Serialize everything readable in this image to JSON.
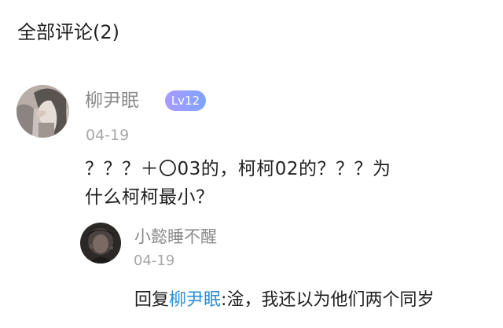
{
  "header": {
    "title": "全部评论(2)"
  },
  "comment": {
    "username": "柳尹眠",
    "level": "Lv12",
    "date": "04-19",
    "text_line1": "？？？＋〇03的，柯柯02的？？？为",
    "text_line2": "什么柯柯最小？"
  },
  "reply": {
    "username": "小懿睡不醒",
    "date": "04-19",
    "prefix": "回复",
    "mention": "柳尹眠",
    "separator": ":",
    "text": "淦，我还以为他们两个同岁"
  },
  "colors": {
    "mention": "#2c8fd9",
    "username": "#8a8a8a",
    "date": "#a7a7a7",
    "badge_start": "#a99bff",
    "badge_end": "#7fa3ff"
  },
  "icons": {
    "comment_avatar": "user-avatar-photo",
    "reply_avatar": "user-avatar-photo"
  }
}
